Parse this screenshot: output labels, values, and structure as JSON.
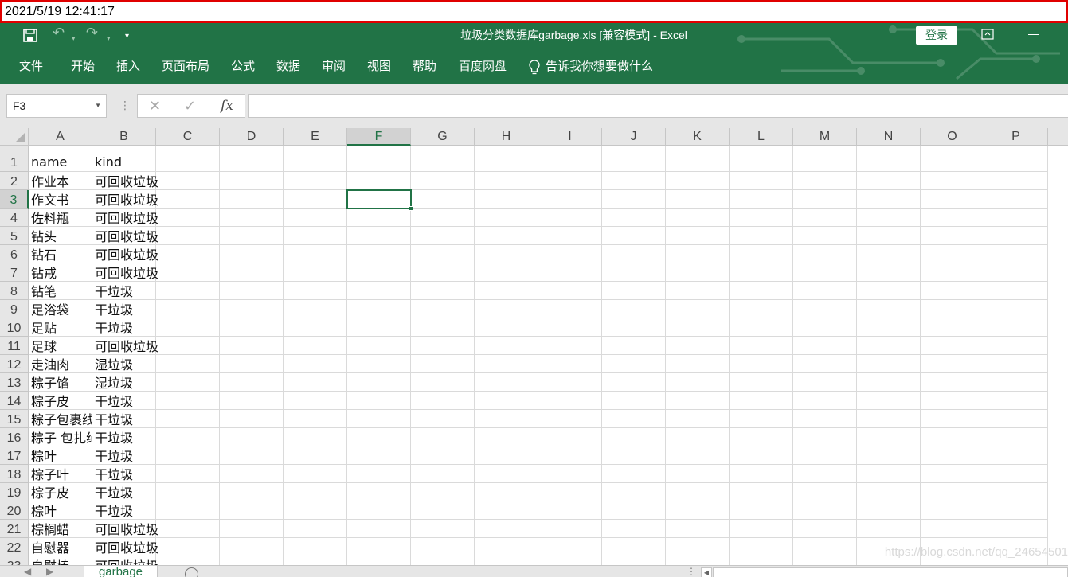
{
  "overlay": {
    "timestamp": "2021/5/19 12:41:17"
  },
  "titlebar": {
    "doc_name": "垃圾分类数据库garbage.xls",
    "compat_mode": "[兼容模式]",
    "separator": "-",
    "app_name": "Excel",
    "login_label": "登录"
  },
  "menu": {
    "items": [
      "文件",
      "开始",
      "插入",
      "页面布局",
      "公式",
      "数据",
      "审阅",
      "视图",
      "帮助",
      "百度网盘"
    ],
    "tell_me": "告诉我你想要做什么"
  },
  "formula_bar": {
    "name_box": "F3",
    "formula": ""
  },
  "grid": {
    "columns": [
      "A",
      "B",
      "C",
      "D",
      "E",
      "F",
      "G",
      "H",
      "I",
      "J",
      "K",
      "L",
      "M",
      "N",
      "O",
      "P"
    ],
    "row_numbers": [
      "1",
      "2",
      "3",
      "4",
      "5",
      "6",
      "7",
      "8",
      "9",
      "10",
      "11",
      "12",
      "13",
      "14",
      "15",
      "16",
      "17",
      "18",
      "19",
      "20",
      "21",
      "22",
      "23"
    ],
    "active_cell": "F3",
    "cells": [
      [
        "name",
        "kind"
      ],
      [
        "作业本",
        "可回收垃圾"
      ],
      [
        "作文书",
        "可回收垃圾"
      ],
      [
        "佐料瓶",
        "可回收垃圾"
      ],
      [
        "钻头",
        "可回收垃圾"
      ],
      [
        "钻石",
        "可回收垃圾"
      ],
      [
        "钻戒",
        "可回收垃圾"
      ],
      [
        "钻笔",
        "干垃圾"
      ],
      [
        "足浴袋",
        "干垃圾"
      ],
      [
        "足贴",
        "干垃圾"
      ],
      [
        "足球",
        "可回收垃圾"
      ],
      [
        "走油肉",
        "湿垃圾"
      ],
      [
        "粽子馅",
        "湿垃圾"
      ],
      [
        "粽子皮",
        "干垃圾"
      ],
      [
        "粽子包裹线",
        "干垃圾"
      ],
      [
        "粽子 包扎绳",
        "干垃圾"
      ],
      [
        "粽叶",
        "干垃圾"
      ],
      [
        "棕子叶",
        "干垃圾"
      ],
      [
        "棕子皮",
        "干垃圾"
      ],
      [
        "棕叶",
        "干垃圾"
      ],
      [
        "棕榈蜡",
        "可回收垃圾"
      ],
      [
        "自慰器",
        "可回收垃圾"
      ],
      [
        "自慰棒",
        "可回收垃圾"
      ]
    ]
  },
  "sheets": {
    "active": "garbage"
  },
  "watermark": "https://blog.csdn.net/qq_24654501",
  "colors": {
    "excel_green": "#217346",
    "overlay_border": "#e00000"
  }
}
